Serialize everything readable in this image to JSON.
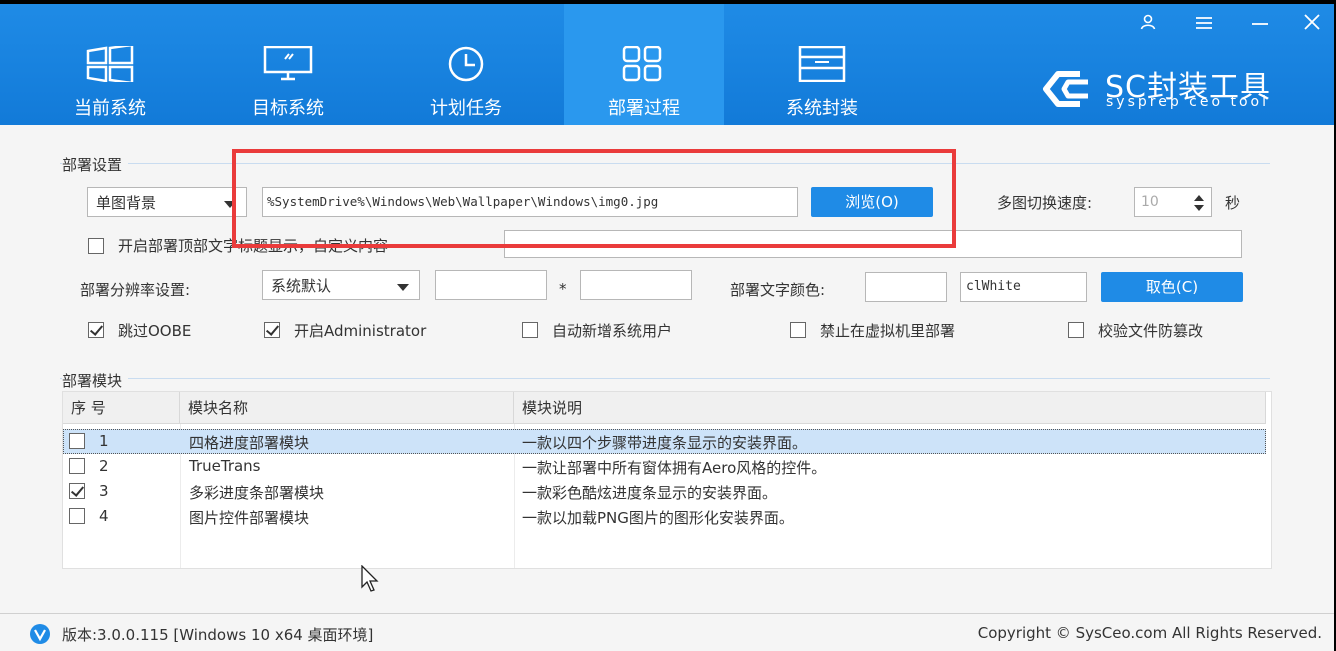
{
  "tabs": [
    {
      "label": "当前系统",
      "icon": "windows-logo-icon"
    },
    {
      "label": "目标系统",
      "icon": "monitor-icon"
    },
    {
      "label": "计划任务",
      "icon": "clock-icon"
    },
    {
      "label": "部署过程",
      "icon": "grid-icon",
      "active": true
    },
    {
      "label": "系统封装",
      "icon": "drawer-icon"
    }
  ],
  "window_controls": {
    "user_icon": "user-icon",
    "menu_icon": "menu-icon",
    "minimize_icon": "minimize-icon",
    "close_icon": "close-icon"
  },
  "brand": {
    "title": "SC封装工具",
    "subtitle": "sysprep ceo tool"
  },
  "deploy_settings": {
    "section_title": "部署设置",
    "background_mode": "单图背景",
    "wallpaper_path": "%SystemDrive%\\Windows\\Web\\Wallpaper\\Windows\\img0.jpg",
    "browse_label": "浏览(O)",
    "switch_speed_label": "多图切换速度:",
    "switch_speed_value": "10",
    "seconds_label": "秒",
    "title_display_label": "开启部署顶部文字标题显示，自定义内容",
    "title_custom_value": "",
    "resolution_label": "部署分辨率设置:",
    "resolution_mode": "系统默认",
    "res_width": "",
    "res_times": "*",
    "res_height": "",
    "text_color_label": "部署文字颜色:",
    "text_color_hex": "",
    "text_color_name": "clWhite",
    "pick_color_label": "取色(C)",
    "options": [
      {
        "label": "跳过OOBE",
        "checked": true
      },
      {
        "label": "开启Administrator",
        "checked": true
      },
      {
        "label": "自动新增系统用户",
        "checked": false
      },
      {
        "label": "禁止在虚拟机里部署",
        "checked": false
      },
      {
        "label": "校验文件防篡改",
        "checked": false
      }
    ]
  },
  "modules": {
    "section_title": "部署模块",
    "columns": [
      "序 号",
      "模块名称",
      "模块说明"
    ],
    "rows": [
      {
        "no": "1",
        "name": "四格进度部署模块",
        "desc": "一款以四个步骤带进度条显示的安装界面。",
        "checked": false,
        "selected": true
      },
      {
        "no": "2",
        "name": "TrueTrans",
        "desc": "一款让部署中所有窗体拥有Aero风格的控件。",
        "checked": false
      },
      {
        "no": "3",
        "name": "多彩进度条部署模块",
        "desc": "一款彩色酷炫进度条显示的安装界面。",
        "checked": true
      },
      {
        "no": "4",
        "name": "图片控件部署模块",
        "desc": "一款以加载PNG图片的图形化安装界面。",
        "checked": false
      }
    ]
  },
  "footer": {
    "version": "版本:3.0.0.115 [Windows 10 x64 桌面环境]",
    "copyright": "Copyright © SysCeo.com All Rights Reserved."
  },
  "colors": {
    "accent": "#1f8be6",
    "highlight_box": "#ea3b3b",
    "selected_row": "#cde3f9"
  }
}
